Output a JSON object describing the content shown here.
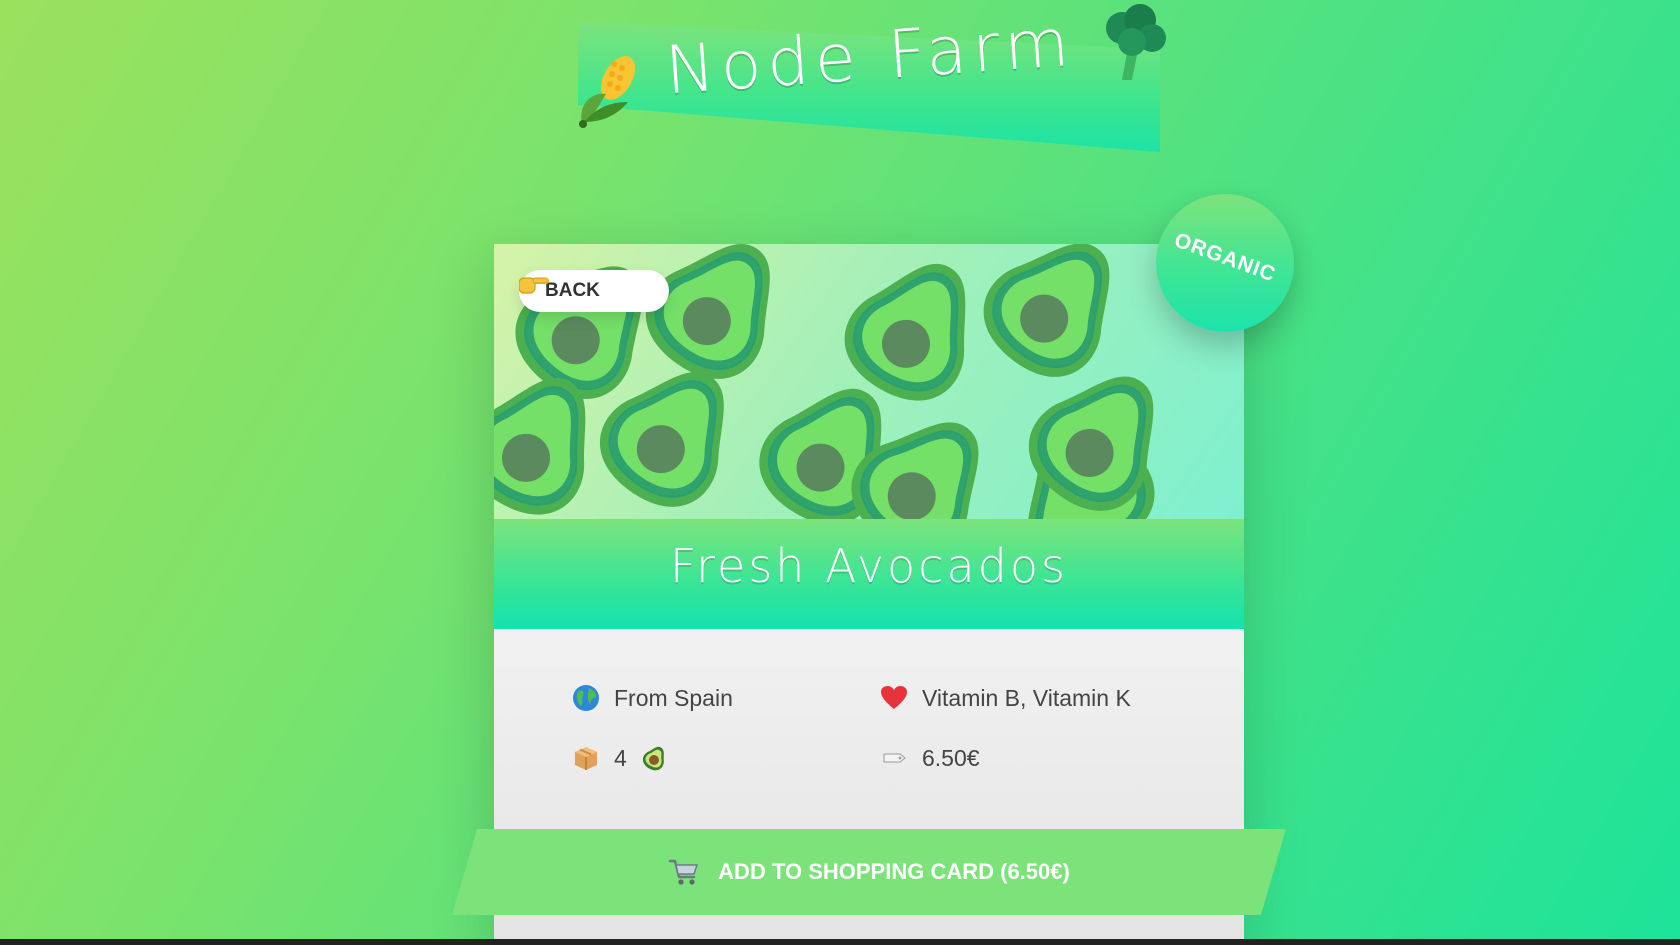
{
  "app": {
    "title": "Node Farm"
  },
  "product": {
    "name": "Fresh Avocados",
    "organic_label": "ORGANIC",
    "from": "From Spain",
    "nutrients": "Vitamin B, Vitamin K",
    "quantity": "4",
    "price": "6.50€"
  },
  "actions": {
    "back_label": "BACK",
    "add_to_cart_label": "ADD TO SHOPPING CARD (6.50€)"
  },
  "icons": {
    "header_left": "corn-icon",
    "header_right": "broccoli-icon",
    "back": "pointing-hand-icon",
    "from": "globe-icon",
    "nutrients": "heart-icon",
    "quantity": "package-icon",
    "quantity_unit": "avocado-icon",
    "price": "price-tag-icon",
    "cart": "shopping-cart-icon"
  },
  "colors": {
    "accent_green": "#7be37a",
    "accent_teal": "#1de3a6",
    "heart_red": "#e8323c"
  }
}
